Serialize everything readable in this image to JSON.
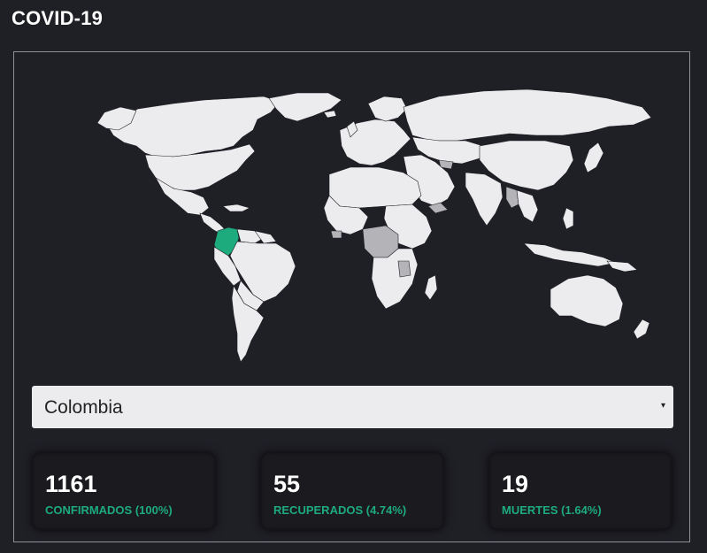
{
  "header": {
    "title": "COVID-19"
  },
  "map": {
    "highlighted_country": "Colombia",
    "highlight_color": "#1dab7d",
    "land_color": "#ececee",
    "no_data_color": "#b4b4b8"
  },
  "country_select": {
    "selected": "Colombia",
    "arrow": "▾"
  },
  "stats": [
    {
      "value": "1161",
      "label": "CONFIRMADOS (100%)"
    },
    {
      "value": "55",
      "label": "RECUPERADOS (4.74%)"
    },
    {
      "value": "19",
      "label": "MUERTES (1.64%)"
    }
  ],
  "colors": {
    "background": "#1f1f26",
    "accent": "#1dab7d",
    "card_border": "#8f8f96"
  }
}
